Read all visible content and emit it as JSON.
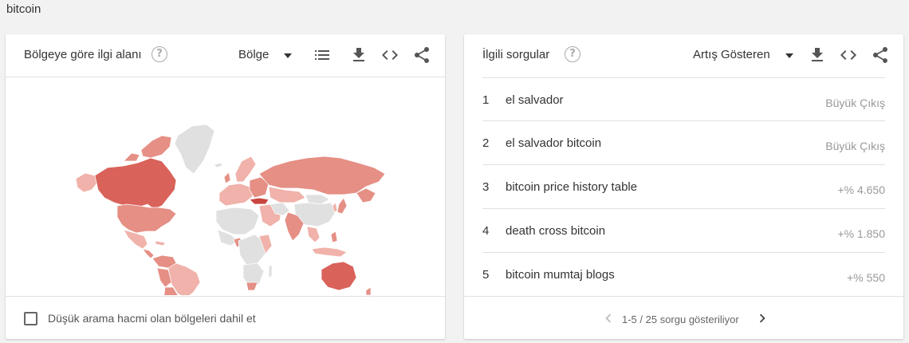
{
  "search_term": "bitcoin",
  "region_card": {
    "title": "Bölgeye göre ilgi alanı",
    "help": "?",
    "selector_label": "Bölge",
    "icons": [
      "list-icon",
      "download-icon",
      "embed-code-icon",
      "share-icon"
    ],
    "low_volume_checkbox_label": "Düşük arama hacmi olan bölgeleri dahil et",
    "low_volume_checked": false
  },
  "queries_card": {
    "title": "İlgili sorgular",
    "help": "?",
    "selector_label": "Artış Gösteren",
    "icons": [
      "download-icon",
      "embed-code-icon",
      "share-icon"
    ],
    "rows": [
      {
        "rank": "1",
        "query": "el salvador",
        "value": "Büyük Çıkış"
      },
      {
        "rank": "2",
        "query": "el salvador bitcoin",
        "value": "Büyük Çıkış"
      },
      {
        "rank": "3",
        "query": "bitcoin price history table",
        "value": "+% 4.650"
      },
      {
        "rank": "4",
        "query": "death cross bitcoin",
        "value": "+% 1.850"
      },
      {
        "rank": "5",
        "query": "bitcoin mumtaj blogs",
        "value": "+% 550"
      }
    ],
    "pagination": "1-5 / 25 sorgu gösteriliyor"
  },
  "colors": {
    "map_no_data": "#e0e0e0",
    "map_light": "#f0b2aa",
    "map_medium": "#e58f85",
    "map_strong": "#d9625a",
    "map_darkest": "#c9453f",
    "map_border": "#ffffff"
  }
}
